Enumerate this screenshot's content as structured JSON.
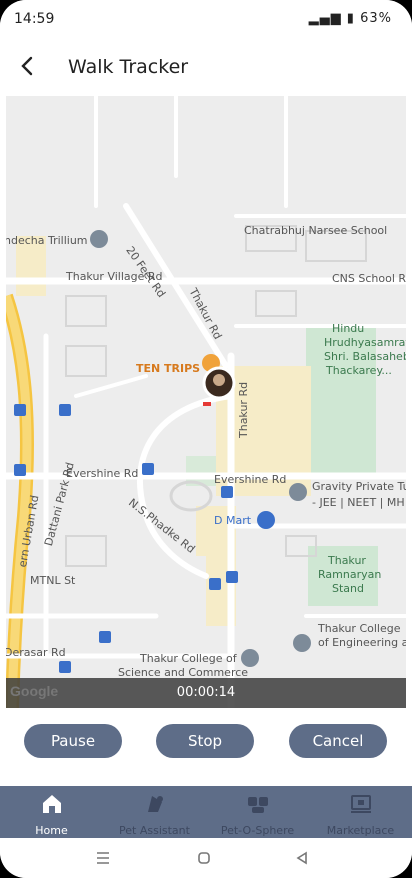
{
  "status": {
    "time": "14:59",
    "battery": "63%"
  },
  "header": {
    "title": "Walk Tracker"
  },
  "map": {
    "labels": {
      "chatrabhuj": "Chatrabhuj Narsee School",
      "thakur_village": "Thakur Village Rd",
      "cns": "CNS School Rd",
      "feet20": "20 Feet Rd",
      "thakur_rd": "Thakur Rd",
      "hindu1": "Hindu",
      "hindu2": "Hrudhyasamrat",
      "hindu3": "Shri. Balasaheb",
      "hindu4": "Thackarey...",
      "ten_trips": "TEN TRIPS",
      "evershine1": "Evershine Rd",
      "evershine2": "Evershine Rd",
      "gravity": "Gravity Private Tu",
      "gravity2": "- JEE | NEET | MH",
      "dmart": "D Mart",
      "nsphadke": "N.S.Phadke Rd",
      "dattani": "Dattani Park Rd",
      "mtnl": "MTNL St",
      "derasar": "Derasar Rd",
      "thakur_ramnaryan1": "Thakur",
      "thakur_ramnaryan2": "Ramnaryan",
      "thakur_ramnaryan3": "Stand",
      "thakur_college1": "Thakur College",
      "thakur_college2": "of Engineering an",
      "thakur_science1": "Thakur College of",
      "thakur_science2": "Science and Commerce",
      "urban": "ern Urban Rd",
      "dandecha": "ndecha Trillium"
    },
    "timer": "00:00:14",
    "google": "Google"
  },
  "controls": {
    "pause": "Pause",
    "stop": "Stop",
    "cancel": "Cancel"
  },
  "nav": {
    "home": "Home",
    "pet_assistant": "Pet Assistant",
    "pet_o_sphere": "Pet-O-Sphere",
    "marketplace": "Marketplace"
  },
  "colors": {
    "accent": "#5e6d88",
    "active": "#ffffff",
    "inactive": "#3d4860"
  }
}
